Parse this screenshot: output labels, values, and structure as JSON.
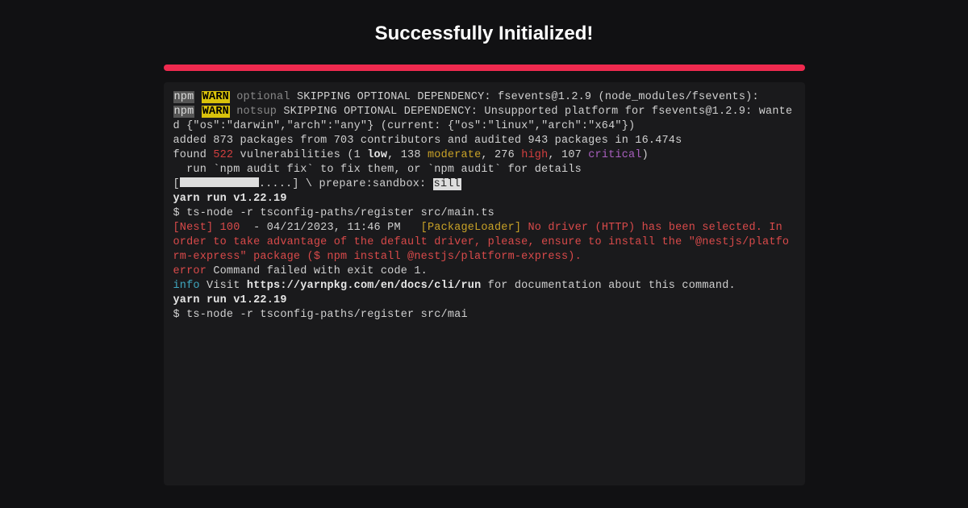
{
  "header": {
    "title": "Successfully Initialized!"
  },
  "terminal": {
    "npm_label": "npm",
    "warn_label": "WARN",
    "optional_keyword": "optional",
    "notsup_keyword": "notsup",
    "skip_msg_1": " SKIPPING OPTIONAL DEPENDENCY: fsevents@1.2.9 (node_modules/fsevents):",
    "skip_msg_2": " SKIPPING OPTIONAL DEPENDENCY: Unsupported platform for fsevents@1.2.9: wanted {\"os\":\"darwin\",\"arch\":\"any\"} (current: {\"os\":\"linux\",\"arch\":\"x64\"})",
    "blank": "",
    "added_line": "added 873 packages from 703 contributors and audited 943 packages in 16.474s",
    "found_prefix": "found ",
    "vuln_count": "522",
    "found_middle": " vulnerabilities (1 ",
    "low_label": "low",
    "after_low": ", 138 ",
    "moderate_label": "moderate",
    "after_moderate": ", 276 ",
    "high_label": "high",
    "after_high": ", 107 ",
    "critical_label": "critical",
    "found_end": ")",
    "audit_line": "  run `npm audit fix` to fix them, or `npm audit` for details",
    "progress_prefix": "[",
    "progress_dots": ".....] \\ prepare:sandbox: ",
    "sill_label": "sill",
    "yarn_run": "yarn run v1.22.19",
    "ts_node_cmd": "$ ts-node -r tsconfig-paths/register src/main.ts",
    "nest_prefix": "[Nest] 100  ",
    "nest_dash": "- ",
    "nest_date": "04/21/2023, 11:46 PM   ",
    "package_loader": "[PackageLoader] ",
    "nest_error": "No driver (HTTP) has been selected. In order to take advantage of the default driver, please, ensure to install the \"@nestjs/platform-express\" package ($ npm install @nestjs/platform-express).",
    "error_label": "error",
    "error_msg": " Command failed with exit code 1.",
    "info_label": "info",
    "info_prefix": " Visit ",
    "info_url": "https://yarnpkg.com/en/docs/cli/run",
    "info_suffix": " for documentation about this command.",
    "ts_node_cmd2": "$ ts-node -r tsconfig-paths/register src/mai"
  }
}
